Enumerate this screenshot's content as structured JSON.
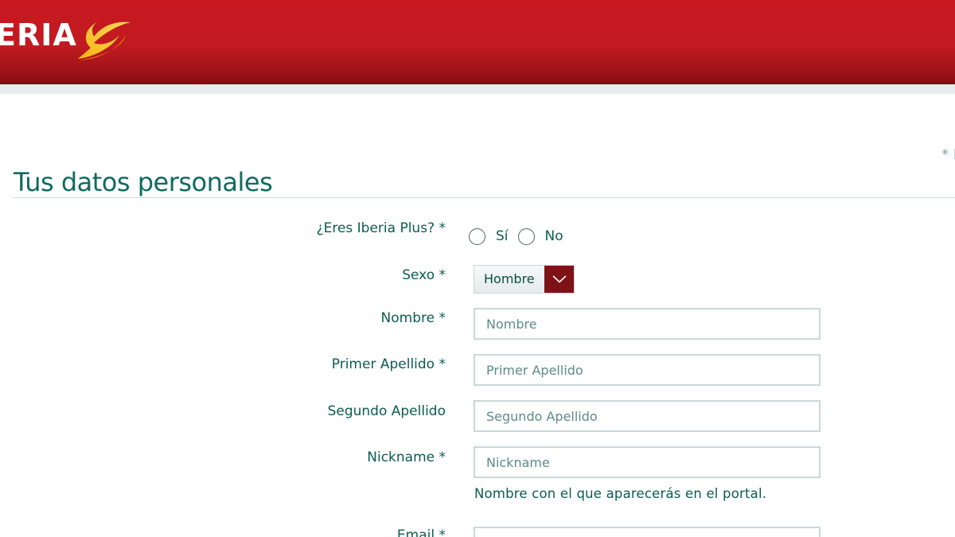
{
  "header": {
    "logo_text": "ERIA",
    "brand_color": "#c8181f",
    "logo_icon": "iberia-wing-icon"
  },
  "page": {
    "title": "Tus datos personales",
    "required_note": "* I"
  },
  "form": {
    "iberia_plus": {
      "label": "¿Eres Iberia Plus? *",
      "options": [
        {
          "label": "Sí",
          "selected": false
        },
        {
          "label": "No",
          "selected": false
        }
      ]
    },
    "sexo": {
      "label": "Sexo *",
      "selected": "Hombre",
      "icon": "chevron-down-icon"
    },
    "nombre": {
      "label": "Nombre *",
      "placeholder": "Nombre",
      "value": ""
    },
    "primer_apellido": {
      "label": "Primer Apellido *",
      "placeholder": "Primer Apellido",
      "value": ""
    },
    "segundo_apellido": {
      "label": "Segundo Apellido",
      "placeholder": "Segundo Apellido",
      "value": ""
    },
    "nickname": {
      "label": "Nickname *",
      "placeholder": "Nickname",
      "value": "",
      "hint": "Nombre con el que aparecerás en el portal."
    },
    "email": {
      "label": "Email *",
      "value": ""
    }
  }
}
